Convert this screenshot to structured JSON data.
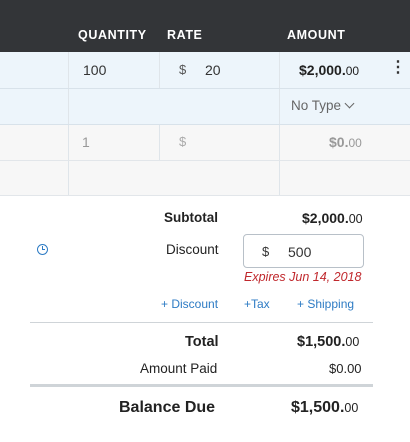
{
  "header": {
    "quantity": "QUANTITY",
    "rate": "RATE",
    "amount": "AMOUNT"
  },
  "line_item": {
    "quantity": "100",
    "rate_currency": "$",
    "rate": "20",
    "amount_main": "$2,000.",
    "amount_cents": "00",
    "menu_icon": "kebab-icon"
  },
  "type_row": {
    "type_label": "No Type"
  },
  "new_item": {
    "quantity_placeholder": "1",
    "rate_currency": "$",
    "amount_main": "$0.",
    "amount_cents": "00"
  },
  "summary": {
    "subtotal_label": "Subtotal",
    "subtotal_main": "$2,000.",
    "subtotal_cents": "00",
    "discount_label": "Discount",
    "discount_currency": "$",
    "discount_value": "500",
    "expires": "Expires Jun 14, 2018",
    "add_discount": "+ Discount",
    "add_tax": "+Tax",
    "add_shipping": "+ Shipping",
    "total_label": "Total",
    "total_main": "$1,500.",
    "total_cents": "00",
    "amount_paid_label": "Amount Paid",
    "amount_paid_value": "$0.00",
    "balance_due_label": "Balance Due",
    "balance_main": "$1,500.",
    "balance_cents": "00"
  },
  "colors": {
    "header_bg": "#333538",
    "link": "#2d7bc4",
    "expires": "#c0282d",
    "row_highlight": "#edf5fb"
  }
}
